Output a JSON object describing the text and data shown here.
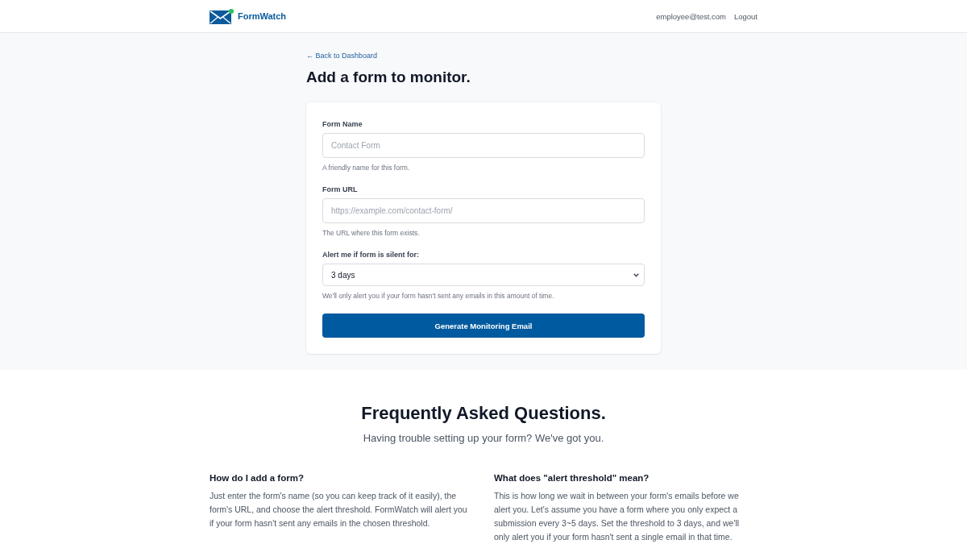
{
  "header": {
    "brand": "FormWatch",
    "user_email": "employee@test.com",
    "logout": "Logout"
  },
  "back_link": "← Back to Dashboard",
  "page_title": "Add a form to monitor.",
  "form": {
    "fields": [
      {
        "kind": "text",
        "label": "Form Name",
        "placeholder": "Contact Form",
        "help": "A friendly name for this form."
      },
      {
        "kind": "text",
        "label": "Form URL",
        "placeholder": "https://example.com/contact-form/",
        "help": "The URL where this form exists."
      },
      {
        "kind": "select",
        "label": "Alert me if form is silent for:",
        "value": "3 days",
        "help": "We'll only alert you if your form hasn't sent any emails in this amount of time."
      }
    ],
    "submit": "Generate Monitoring Email"
  },
  "faq": {
    "title": "Frequently Asked Questions.",
    "subtitle": "Having trouble setting up your form? We've got you.",
    "items": [
      {
        "question": "How do I add a form?",
        "answer": "Just enter the form's name (so you can keep track of it easily), the form's URL, and choose the alert threshold. FormWatch will alert you if your form hasn't sent any emails in the chosen threshold."
      },
      {
        "question": "What does \"alert threshold\" mean?",
        "answer": "This is how long we wait in between your form's emails before we alert you. Let's assume you have a form where you only expect a submission every 3~5 days. Set the threshold to 3 days, and we'll only alert you if your form hasn't sent a single email in that time."
      }
    ]
  }
}
